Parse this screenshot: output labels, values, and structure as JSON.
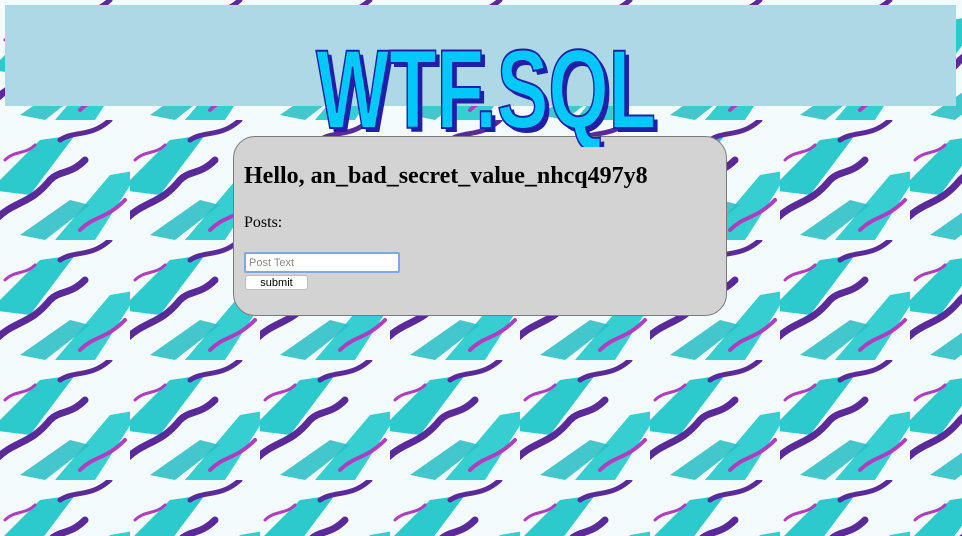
{
  "header": {
    "logo_text": "WTF.SQL"
  },
  "main": {
    "greeting": "Hello, an_bad_secret_value_nhcq497y8",
    "posts_label": "Posts:",
    "post_input": {
      "placeholder": "Post Text",
      "value": ""
    },
    "submit_label": "submit"
  },
  "colors": {
    "header_bar": "#add8e6",
    "card": "#d3d3d3",
    "logo_fill": "#00c8f8",
    "logo_outline": "#1f1fa8",
    "pattern_teal": "#2cc9cd",
    "pattern_purple": "#5a2a9a",
    "pattern_magenta": "#b03cc0"
  },
  "icons": {
    "logo": "wtf-sql-wordart-logo"
  }
}
